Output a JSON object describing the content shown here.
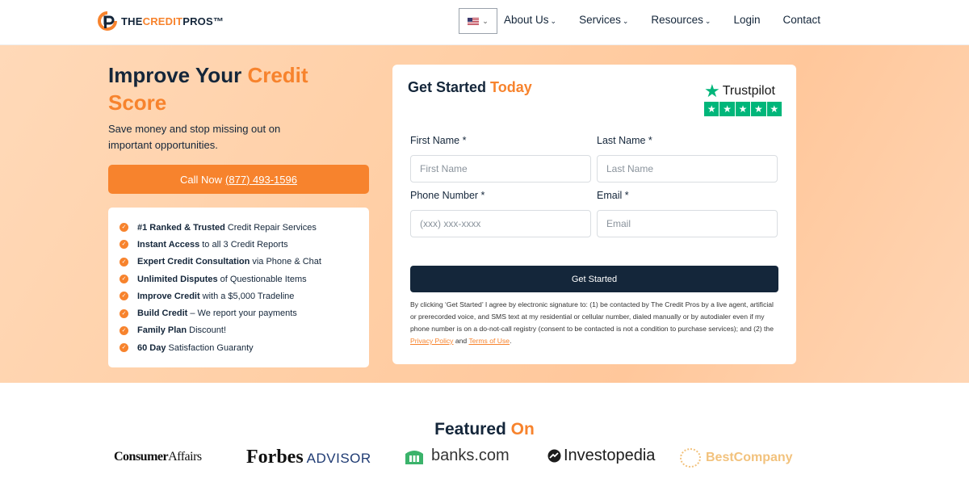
{
  "header": {
    "logo": {
      "prefix": "THE",
      "accent": "CREDIT",
      "suffix": "PROS™"
    },
    "nav": [
      {
        "label": "About Us",
        "dropdown": true
      },
      {
        "label": "Services",
        "dropdown": true
      },
      {
        "label": "Resources",
        "dropdown": true
      },
      {
        "label": "Login",
        "dropdown": false
      },
      {
        "label": "Contact",
        "dropdown": false
      }
    ]
  },
  "hero": {
    "title_main": "Improve Your",
    "title_accent": "Credit Score",
    "subtitle": "Save money and stop missing out on important opportunities.",
    "call_prefix": "Call Now",
    "call_number": "(877) 493-1596",
    "features": [
      {
        "bold": "#1 Ranked & Trusted",
        "rest": "Credit Repair Services"
      },
      {
        "bold": "Instant Access",
        "rest": "to all 3 Credit Reports"
      },
      {
        "bold": "Expert Credit Consultation",
        "rest": "via Phone & Chat"
      },
      {
        "bold": "Unlimited Disputes",
        "rest": "of Questionable Items"
      },
      {
        "bold": "Improve Credit",
        "rest": "with a $5,000 Tradeline"
      },
      {
        "bold": "Build Credit",
        "rest": "– We report your payments"
      },
      {
        "bold": "Family Plan",
        "rest": "Discount!"
      },
      {
        "bold": "60 Day",
        "rest": "Satisfaction Guaranty"
      }
    ]
  },
  "form": {
    "title_main": "Get Started",
    "title_accent": "Today",
    "trustpilot": "Trustpilot",
    "first_name_label": "First Name *",
    "first_name_placeholder": "First Name",
    "last_name_label": "Last Name *",
    "last_name_placeholder": "Last Name",
    "phone_label": "Phone Number *",
    "phone_placeholder": "(xxx) xxx-xxxx",
    "email_label": "Email *",
    "email_placeholder": "Email",
    "submit_label": "Get Started",
    "legal_text": "By clicking ‘Get Started’ I agree by electronic signature to: (1) be contacted by The Credit Pros by a live agent, artificial or prerecorded voice, and SMS text at my residential or cellular number, dialed manually or by autodialer even if my phone number is on a do-not-call registry (consent to be contacted is not a condition to purchase services); and (2) the",
    "privacy_link": "Privacy Policy",
    "and_text": "and",
    "terms_link": "Terms of Use",
    "period": "."
  },
  "featured": {
    "title_main": "Featured",
    "title_accent": "On",
    "brands": {
      "consumeraffairs_bold": "Consumer",
      "consumeraffairs_rest": "Affairs",
      "forbes": "Forbes",
      "forbes_advisor": "ADVISOR",
      "banks": "banks.com",
      "investopedia": "Investopedia",
      "bestcompany": "BestCompany"
    }
  },
  "colors": {
    "accent": "#f7832d",
    "navy": "#14263a",
    "trustpilot_green": "#00b67a"
  }
}
